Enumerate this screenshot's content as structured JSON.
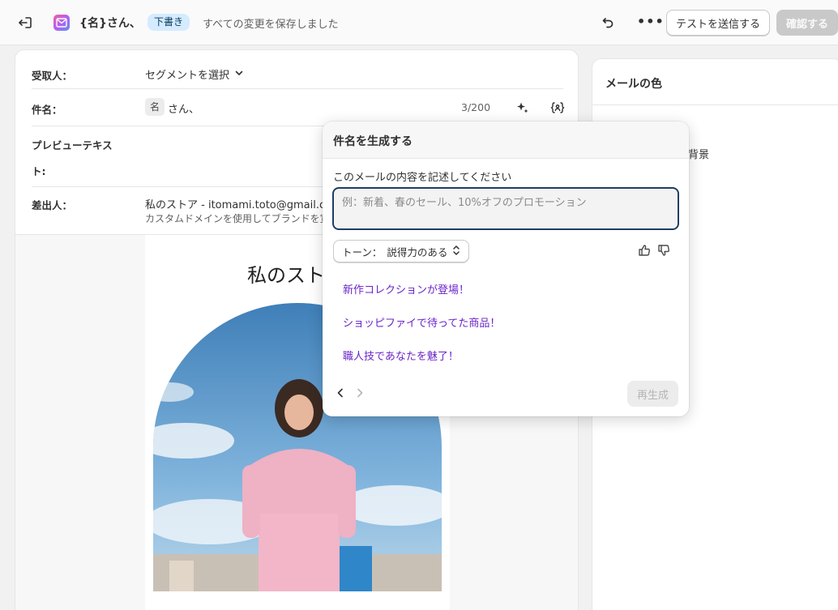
{
  "topbar": {
    "title": "{名}さん、",
    "badge": "下書き",
    "saved_status": "すべての変更を保存しました",
    "more_label": "•••",
    "send_test_label": "テストを送信する",
    "confirm_label": "確認する"
  },
  "editor": {
    "to_label": "受取人：",
    "segment_select": "セグメントを選択",
    "subject_label": "件名：",
    "subject_chip": "名",
    "subject_text": "さん、",
    "subject_counter": "3/200",
    "preview_label": "プレビューテキスト:",
    "from_label": "差出人：",
    "from_value": "私のストア - itomami.toto@gmail.com v",
    "from_note": "カスタムドメインを使用してブランドを宣伝"
  },
  "email_preview": {
    "store_name": "私のストア"
  },
  "right_panel": {
    "title": "メールの色",
    "item_visible": "ツの背景"
  },
  "popover": {
    "title": "件名を生成する",
    "prompt_label": "このメールの内容を記述してください",
    "prompt_placeholder": "例：新着、春のセール、10%オフのプロモーション",
    "tone_label": "トーン：",
    "tone_value": "説得力のある",
    "suggestions": [
      "新作コレクションが登場！",
      "ショッピファイで待ってた商品！",
      "職人技であなたを魅了！"
    ],
    "regenerate_label": "再生成"
  },
  "colors": {
    "accent_purple": "#6a24c9",
    "input_border": "#1f3e63",
    "badge_bg": "#d5ebff"
  }
}
